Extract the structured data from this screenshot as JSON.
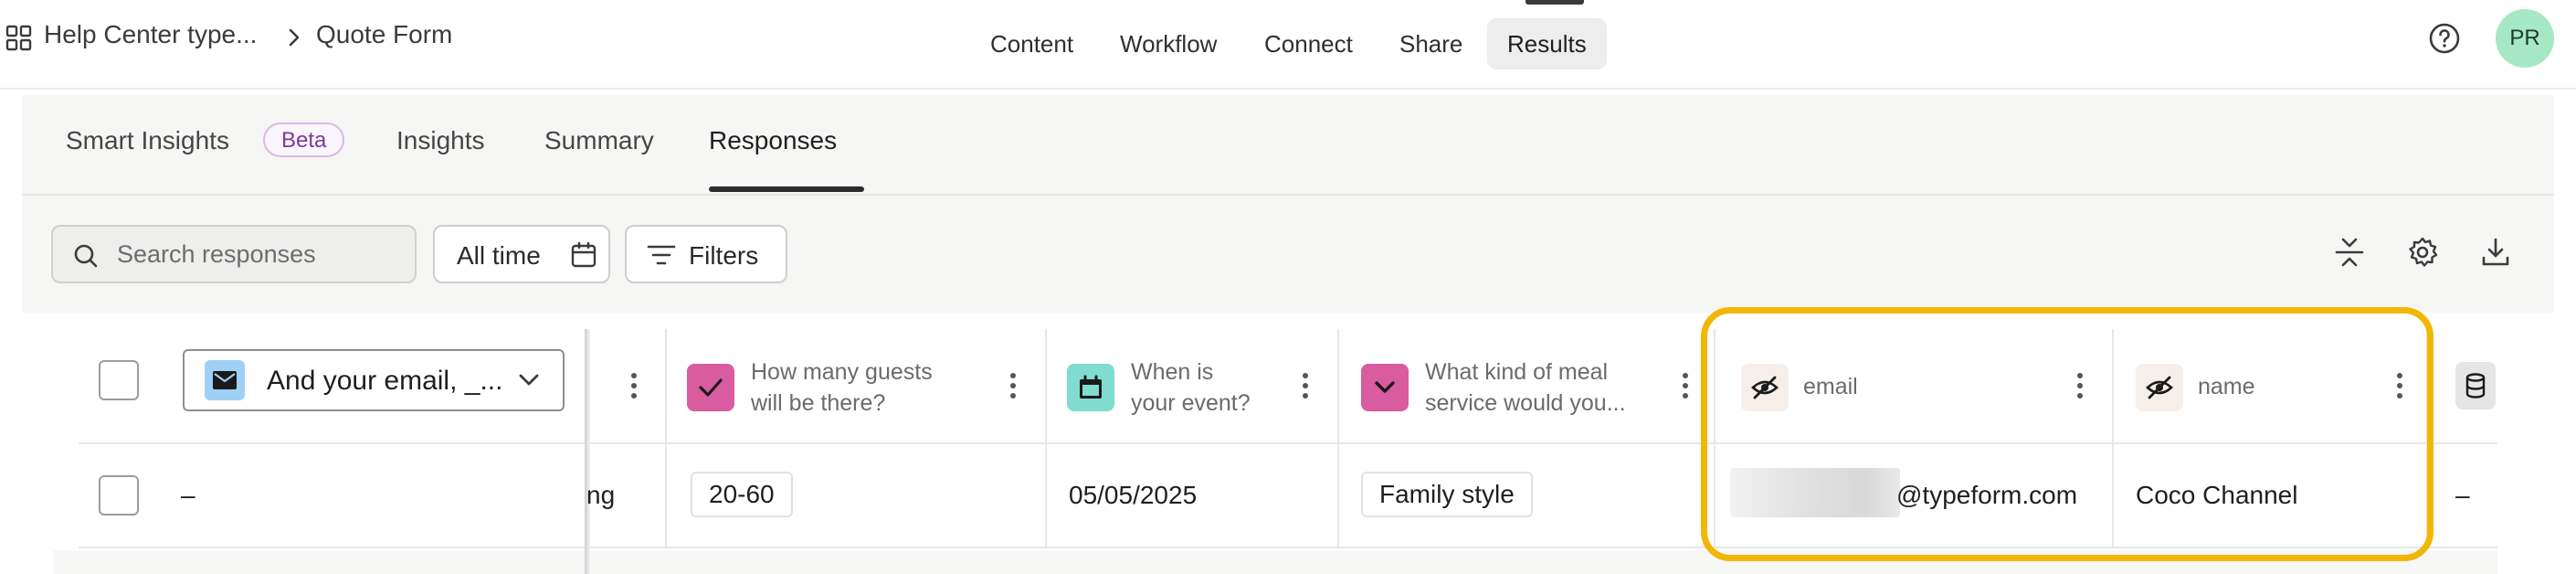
{
  "header": {
    "workspace": "Help Center type...",
    "form_name": "Quote Form",
    "nav_tabs": [
      {
        "label": "Content"
      },
      {
        "label": "Workflow"
      },
      {
        "label": "Connect"
      },
      {
        "label": "Share"
      },
      {
        "label": "Results"
      }
    ],
    "active_tab": "Results",
    "avatar_initials": "PR"
  },
  "results": {
    "tabs": [
      {
        "label": "Smart Insights"
      },
      {
        "label": "Insights"
      },
      {
        "label": "Summary"
      },
      {
        "label": "Responses"
      }
    ],
    "beta_label": "Beta",
    "active_tab": "Responses",
    "search_placeholder": "Search responses",
    "date_filter_label": "All time",
    "filters_label": "Filters"
  },
  "table": {
    "question_selector": "And your email, _...",
    "columns": [
      {
        "title_line1": "How many guests",
        "title_line2": "will be there?",
        "icon": "checkmark-icon",
        "color": "#d95ba0"
      },
      {
        "title_line1": "When is",
        "title_line2": "your event?",
        "icon": "calendar-icon",
        "color": "#7fdccf"
      },
      {
        "title_line1": "What kind of meal",
        "title_line2": "service would you...",
        "icon": "dropdown-icon",
        "color": "#d95ba0"
      },
      {
        "title_line1": "email",
        "title_line2": "",
        "icon": "hidden-eye-icon",
        "color": "#f6efe9"
      },
      {
        "title_line1": "name",
        "title_line2": "",
        "icon": "hidden-eye-icon",
        "color": "#f6efe9"
      }
    ],
    "row": {
      "first_cell": "–",
      "truncated_cell": "ng",
      "guests": "20-60",
      "event_date": "05/05/2025",
      "meal_service": "Family style",
      "email_suffix": "@typeform.com",
      "name": "Coco Channel",
      "last_cell": "–"
    }
  },
  "colors": {
    "highlight": "#f2b705",
    "avatar_bg": "#a6e8c3",
    "beta_border": "#d9b9eb"
  }
}
